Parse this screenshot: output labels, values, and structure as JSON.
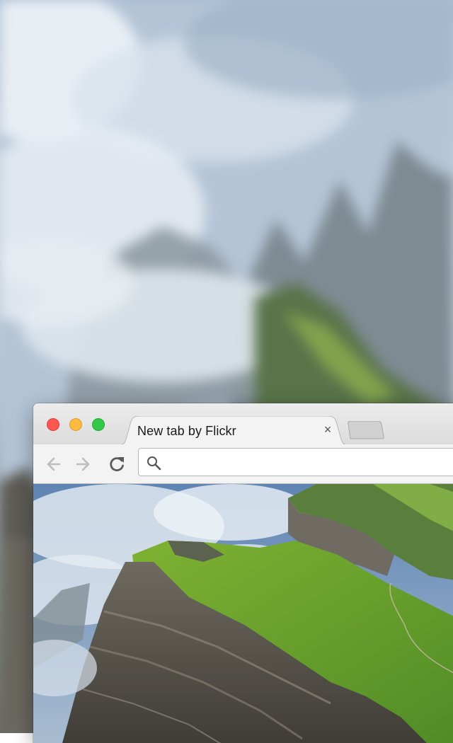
{
  "browser": {
    "tab": {
      "title": "New tab by Flickr",
      "close_glyph": "×",
      "icon": "close-icon"
    },
    "toolbar": {
      "back_icon": "arrow-left-icon",
      "forward_icon": "arrow-right-icon",
      "reload_icon": "reload-icon",
      "search_icon": "search-icon",
      "omnibox_value": ""
    },
    "window_controls": [
      "close",
      "minimize",
      "zoom"
    ]
  },
  "colors": {
    "close": "#fc5753",
    "minimize": "#fdbc40",
    "zoom": "#34c84a"
  }
}
